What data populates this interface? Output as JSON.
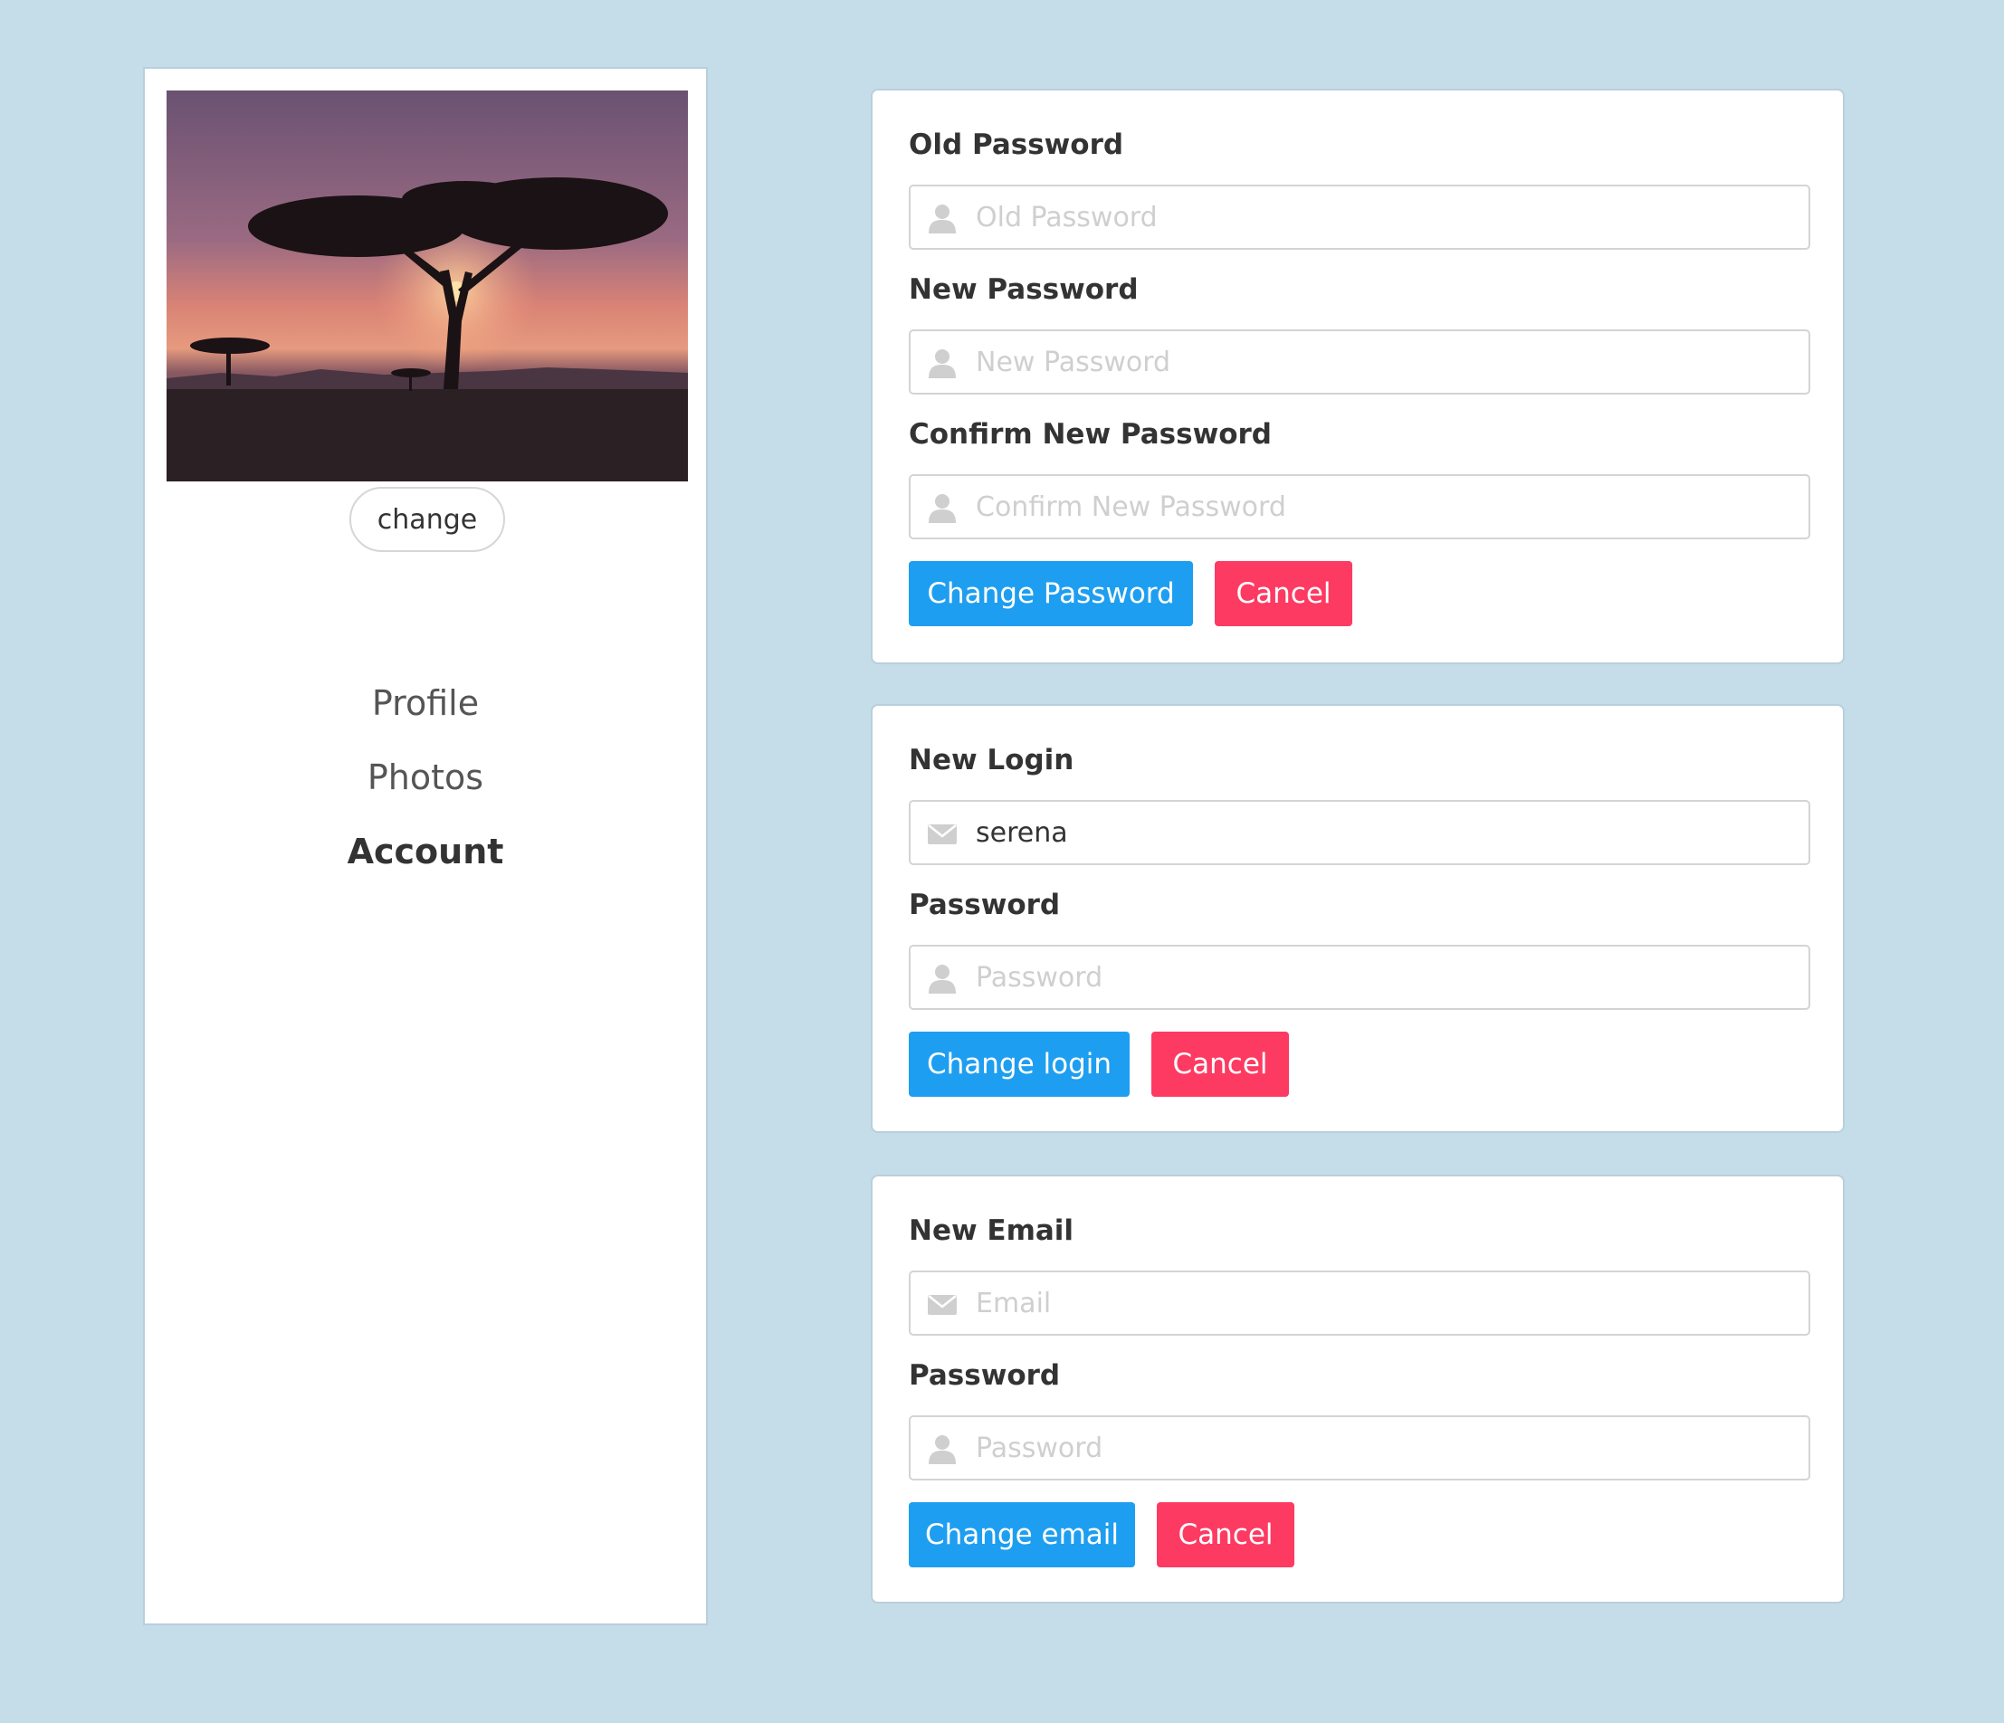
{
  "sidebar": {
    "change_label": "change",
    "nav": [
      {
        "label": "Profile",
        "active": false
      },
      {
        "label": "Photos",
        "active": false
      },
      {
        "label": "Account",
        "active": true
      }
    ]
  },
  "password_card": {
    "old_label": "Old Password",
    "old_placeholder": "Old Password",
    "new_label": "New Password",
    "new_placeholder": "New Password",
    "confirm_label": "Confirm New Password",
    "confirm_placeholder": "Confirm New Password",
    "submit_label": "Change Password",
    "cancel_label": "Cancel"
  },
  "login_card": {
    "login_label": "New Login",
    "login_value": "serena",
    "password_label": "Password",
    "password_placeholder": "Password",
    "submit_label": "Change login",
    "cancel_label": "Cancel"
  },
  "email_card": {
    "email_label": "New Email",
    "email_placeholder": "Email",
    "password_label": "Password",
    "password_placeholder": "Password",
    "submit_label": "Change email",
    "cancel_label": "Cancel"
  },
  "colors": {
    "background": "#c5dce9",
    "primary": "#1e9ef0",
    "danger": "#fd3a62",
    "card_border": "#b9cfdc"
  },
  "icons": {
    "user": "user-icon",
    "envelope": "envelope-icon"
  }
}
